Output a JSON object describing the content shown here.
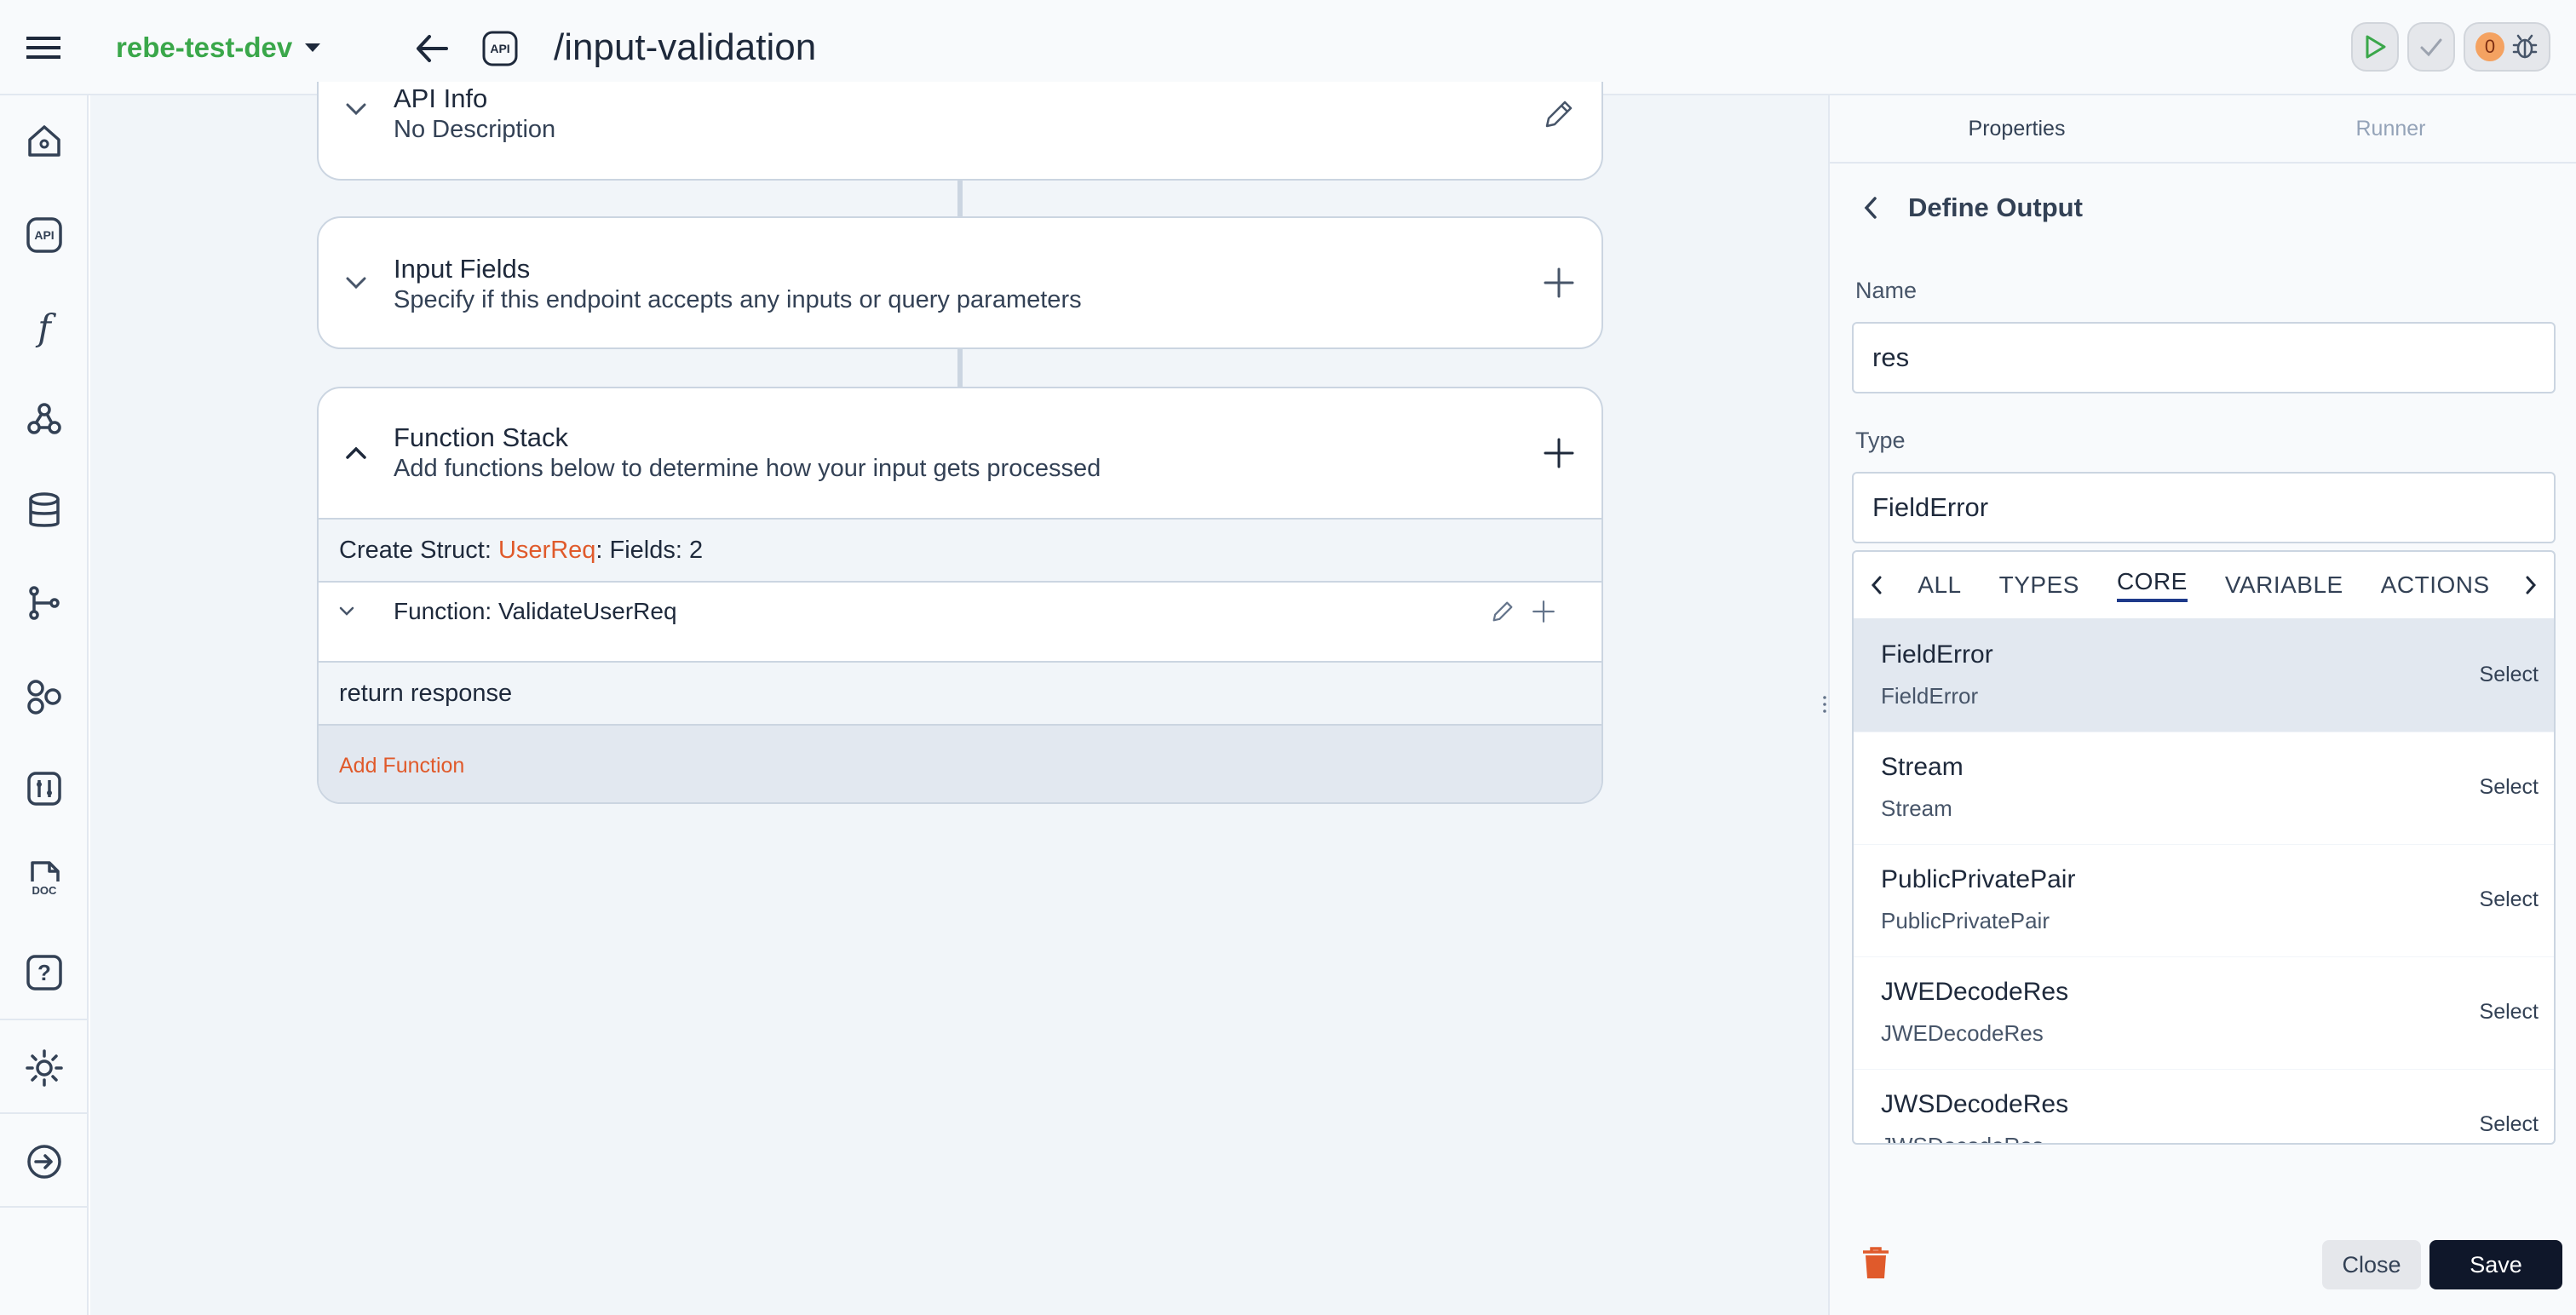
{
  "header": {
    "workspace": "rebe-test-dev",
    "api_badge": "API",
    "title": "/input-validation",
    "error_count": "0"
  },
  "sidebar": {
    "items": [
      {
        "name": "home-icon"
      },
      {
        "name": "api-icon",
        "label": "API"
      },
      {
        "name": "function-icon",
        "label": "f"
      },
      {
        "name": "webhook-icon"
      },
      {
        "name": "database-icon"
      },
      {
        "name": "branch-icon"
      },
      {
        "name": "components-icon"
      },
      {
        "name": "settings-sliders-icon"
      },
      {
        "name": "docs-icon",
        "label": "DOC"
      },
      {
        "name": "help-icon",
        "label": "?"
      },
      {
        "name": "theme-sun-icon"
      },
      {
        "name": "logout-icon"
      }
    ]
  },
  "cards": {
    "api_info": {
      "title": "API Info",
      "subtitle": "No Description"
    },
    "input_fields": {
      "title": "Input Fields",
      "subtitle": "Specify if this endpoint accepts any inputs or query parameters"
    },
    "function_stack": {
      "title": "Function Stack",
      "subtitle": "Add functions below to determine how your input gets processed"
    }
  },
  "stack": {
    "struct_prefix": "Create Struct: ",
    "struct_name": "UserReq",
    "struct_suffix": ": Fields: 2",
    "function_label": "Function: ValidateUserReq",
    "return_label": "return response",
    "add_function": "Add Function"
  },
  "panel": {
    "tabs": [
      "Properties",
      "Runner"
    ],
    "heading": "Define Output",
    "name_label": "Name",
    "name_value": "res",
    "type_label": "Type",
    "type_value": "FieldError",
    "dropdown_tabs": [
      "ALL",
      "TYPES",
      "CORE",
      "VARIABLE",
      "ACTIONS"
    ],
    "active_tab": "CORE",
    "options": [
      {
        "name": "FieldError",
        "sub": "FieldError",
        "action": "Select"
      },
      {
        "name": "Stream",
        "sub": "Stream",
        "action": "Select"
      },
      {
        "name": "PublicPrivatePair",
        "sub": "PublicPrivatePair",
        "action": "Select"
      },
      {
        "name": "JWEDecodeRes",
        "sub": "JWEDecodeRes",
        "action": "Select"
      },
      {
        "name": "JWSDecodeRes",
        "sub": "JWSDecodeRes",
        "action": "Select"
      }
    ],
    "close_label": "Close",
    "save_label": "Save"
  },
  "colors": {
    "accent": "#e05a2b",
    "workspace_green": "#3aa74a",
    "save_bg": "#0f172a"
  }
}
